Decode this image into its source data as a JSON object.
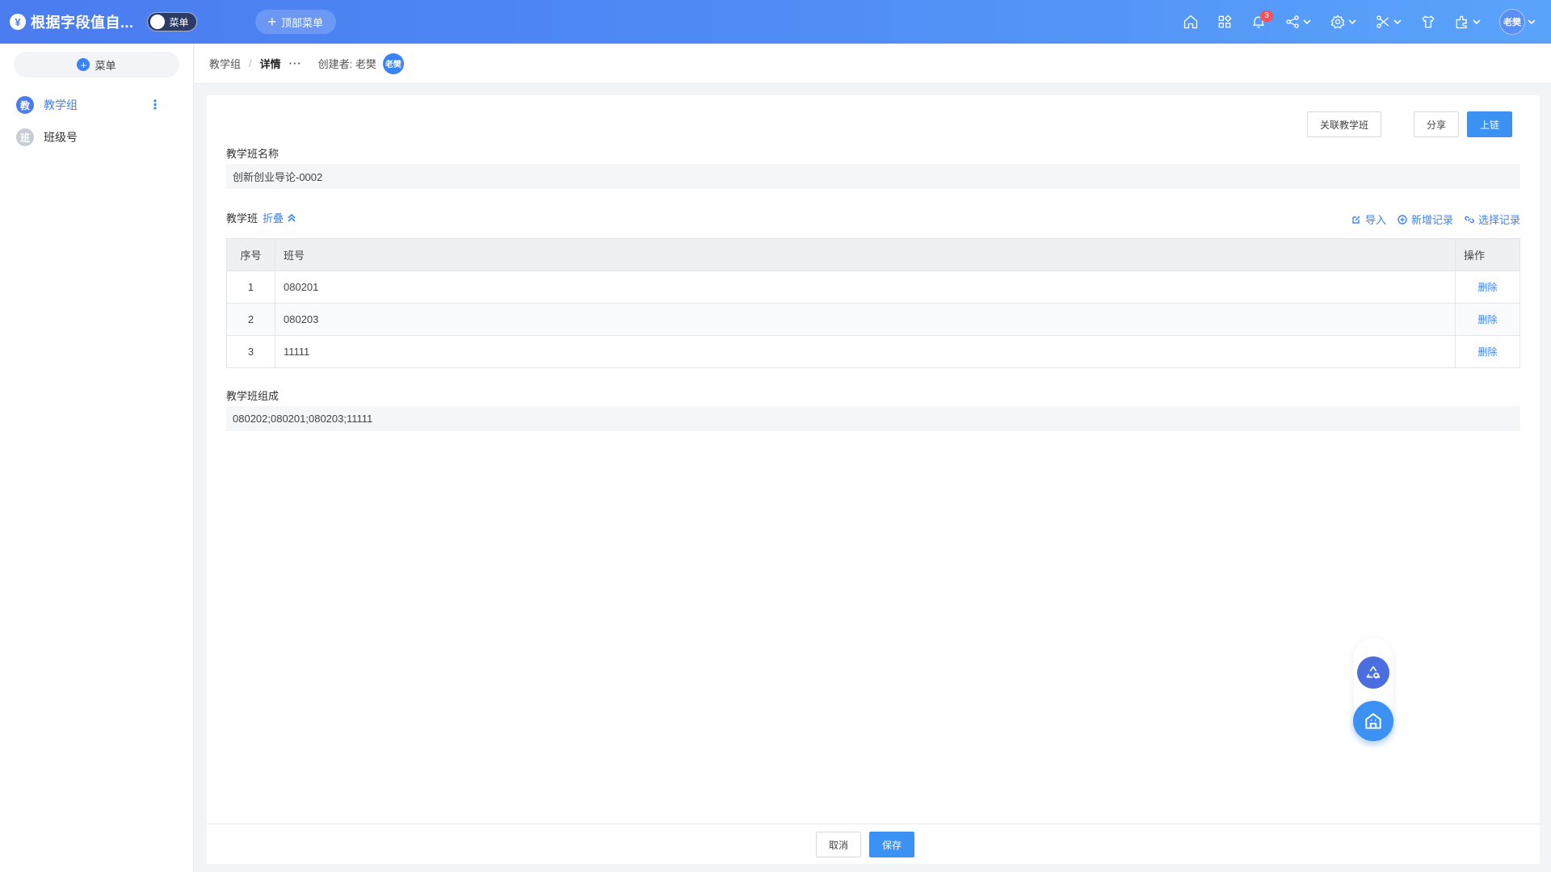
{
  "app": {
    "title": "根据字段值自...",
    "logo_glyph": "¥",
    "menu_toggle_label": "菜单",
    "top_menu_button": "顶部菜单",
    "notification_count": "3",
    "user_avatar": "老樊",
    "accent_color": "#4a7cf0"
  },
  "top_icons": [
    "home-icon",
    "apps-icon",
    "bell-icon",
    "share-icon",
    "settings-icon",
    "tools-icon",
    "shirt-icon",
    "plugin-icon"
  ],
  "sidebar": {
    "add_label": "菜单",
    "items": [
      {
        "icon_text": "教",
        "label": "教学组",
        "active": true
      },
      {
        "icon_text": "班",
        "label": "班级号",
        "active": false
      }
    ]
  },
  "breadcrumb": {
    "root": "教学组",
    "current": "详情",
    "more": "···",
    "creator_label": "创建者: 老樊",
    "creator_avatar": "老樊"
  },
  "toolbar": {
    "link_button": "关联教学班",
    "share_button": "分享",
    "publish_button": "上链"
  },
  "form": {
    "name_label": "教学班名称",
    "name_value": "创新创业导论-0002",
    "section_title": "教学班",
    "fold_label": "折叠",
    "actions": {
      "import": "导入",
      "add": "新增记录",
      "select": "选择记录"
    },
    "table": {
      "headers": {
        "idx": "序号",
        "class_no": "班号",
        "op": "操作"
      },
      "rows": [
        {
          "idx": "1",
          "class_no": "080201",
          "op": "删除"
        },
        {
          "idx": "2",
          "class_no": "080203",
          "op": "删除"
        },
        {
          "idx": "3",
          "class_no": "11111",
          "op": "删除"
        }
      ]
    },
    "composition_label": "教学班组成",
    "composition_value": "080202;080201;080203;11111"
  },
  "footer": {
    "cancel": "取消",
    "save": "保存"
  }
}
